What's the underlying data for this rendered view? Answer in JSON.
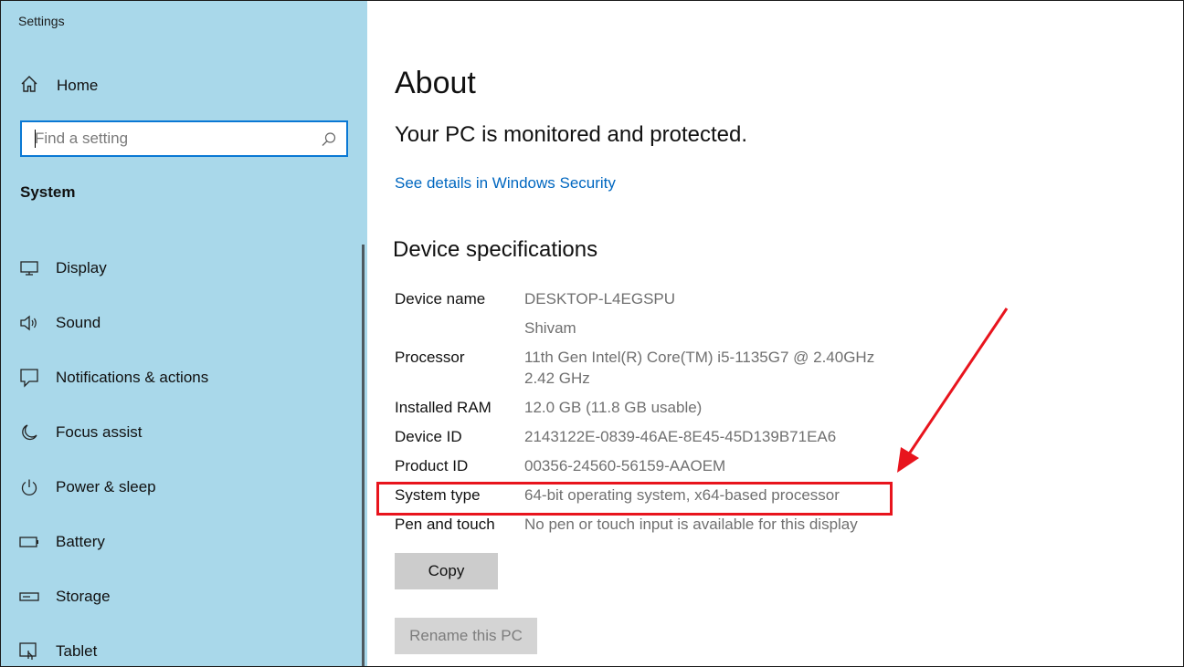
{
  "app": {
    "title": "Settings"
  },
  "sidebar": {
    "home_label": "Home",
    "search_placeholder": "Find a setting",
    "section": "System",
    "items": [
      {
        "label": "Display",
        "icon": "display-icon"
      },
      {
        "label": "Sound",
        "icon": "speaker-icon"
      },
      {
        "label": "Notifications & actions",
        "icon": "notification-icon"
      },
      {
        "label": "Focus assist",
        "icon": "moon-icon"
      },
      {
        "label": "Power & sleep",
        "icon": "power-icon"
      },
      {
        "label": "Battery",
        "icon": "battery-icon"
      },
      {
        "label": "Storage",
        "icon": "storage-icon"
      },
      {
        "label": "Tablet",
        "icon": "tablet-icon"
      }
    ]
  },
  "main": {
    "title": "About",
    "status": "Your PC is monitored and protected.",
    "security_link": "See details in Windows Security",
    "specs_heading": "Device specifications",
    "specs": [
      {
        "key": "Device name",
        "value": "DESKTOP-L4EGSPU",
        "value2": "Shivam"
      },
      {
        "key": "Processor",
        "value": "11th Gen Intel(R) Core(TM) i5-1135G7 @ 2.40GHz",
        "value2": "2.42 GHz"
      },
      {
        "key": "Installed RAM",
        "value": "12.0 GB (11.8 GB usable)"
      },
      {
        "key": "Device ID",
        "value": "2143122E-0839-46AE-8E45-45D139B71EA6"
      },
      {
        "key": "Product ID",
        "value": "00356-24560-56159-AAOEM"
      },
      {
        "key": "System type",
        "value": "64-bit operating system, x64-based processor"
      },
      {
        "key": "Pen and touch",
        "value": "No pen or touch input is available for this display"
      }
    ],
    "copy_label": "Copy",
    "rename_label": "Rename this PC"
  },
  "colors": {
    "sidebar_bg": "#a9d8ea",
    "accent": "#0a78d4",
    "link": "#0067c0",
    "annotation": "#e8141d"
  }
}
